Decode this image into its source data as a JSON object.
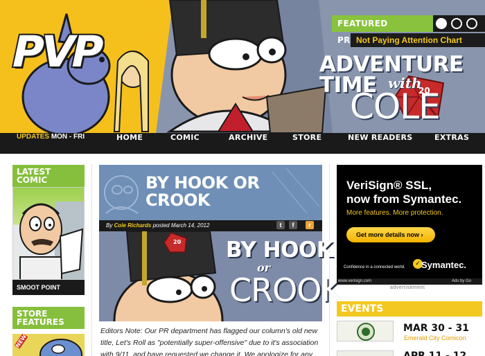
{
  "banner": {
    "logo": "PVP",
    "featured_label": "FEATURED PROJECTS",
    "featured_subtitle": "Not Paying Attention Chart",
    "adv_line1": "ADVENTURE",
    "adv_line2": "TIME",
    "adv_with": "with",
    "adv_cole": "COLE",
    "die_number": "20"
  },
  "nav": {
    "updates_label": "UPDATES",
    "updates_days": "MON - FRI",
    "items": [
      "HOME",
      "COMIC",
      "ARCHIVE",
      "STORE",
      "NEW READERS",
      "EXTRAS"
    ]
  },
  "sidebar": {
    "latest_title_1": "LATEST",
    "latest_title_2": "COMIC",
    "latest_caption": "SMOOT POINT",
    "store_title_1": "STORE",
    "store_title_2": "FEATURES",
    "store_badge": "NEW"
  },
  "article": {
    "header_title_1": "BY HOOK OR",
    "header_title_2": "CROOK",
    "by_prefix": "By",
    "author": "Cole Richards",
    "posted": "posted March 14, 2012",
    "hero_by": "BY HOOK",
    "hero_or": "or",
    "hero_crook": "CROOK",
    "hero_die": "20",
    "body": "Editors Note: Our PR department has flagged our column's old new title, Let's Roll as \"potentially super-offensive\" due to it's association with 9/11, and have requested we change it. We apologize for any confusion."
  },
  "share": {
    "twitter": "t",
    "facebook": "f",
    "rss": "r"
  },
  "ad": {
    "title_1": "VeriSign® SSL,",
    "title_2": "now from Symantec.",
    "subtitle": "More features. More protection.",
    "button": "Get more details now ›",
    "confidence": "Confidence in a connected world.",
    "brand": "Symantec.",
    "url": "www.verisign.com",
    "ads_by": "Ads by Go",
    "label": "advertisement"
  },
  "events": {
    "title": "EVENTS",
    "items": [
      {
        "date": "MAR 30 - 31",
        "name": "Emerald City Comicon"
      },
      {
        "date": "APR 11 - 12",
        "name": ""
      }
    ]
  },
  "colors": {
    "accent_green": "#86bf3c",
    "accent_yellow": "#f3c820",
    "dark": "#1a1a1a"
  }
}
